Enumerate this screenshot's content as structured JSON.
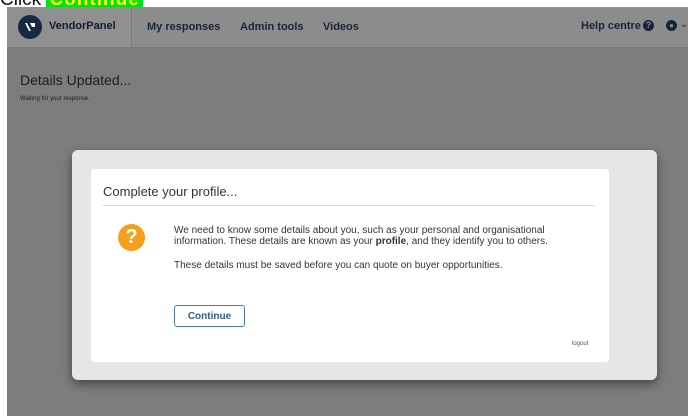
{
  "instruction": {
    "prefix": "Click",
    "highlight": "Continue"
  },
  "header": {
    "brand": "VendorPanel",
    "nav": [
      "My responses",
      "Admin tools",
      "Videos"
    ],
    "help": "Help centre"
  },
  "page": {
    "title": "Details Updated...",
    "subtitle": "Waiting for your response."
  },
  "modal": {
    "title": "Complete your profile...",
    "message_part1": "We need to know some details about you, such as your personal and organisational information. These details are known as your ",
    "message_bold": "profile",
    "message_part2": ", and they identify you to others.",
    "message_line2": "These details must be saved before you can quote on buyer opportunities.",
    "continue_label": "Continue",
    "logout_label": "logout"
  },
  "colors": {
    "overlay": "#7d7d7d",
    "highlight_bg": "#00e11a",
    "highlight_text": "#ffff00",
    "warning_icon": "#f4a01a",
    "button_border": "#4b7aae"
  },
  "icons": [
    "vendorpanel-logo-icon",
    "help-circle-icon",
    "user-icon",
    "chevron-down-icon",
    "question-icon"
  ]
}
